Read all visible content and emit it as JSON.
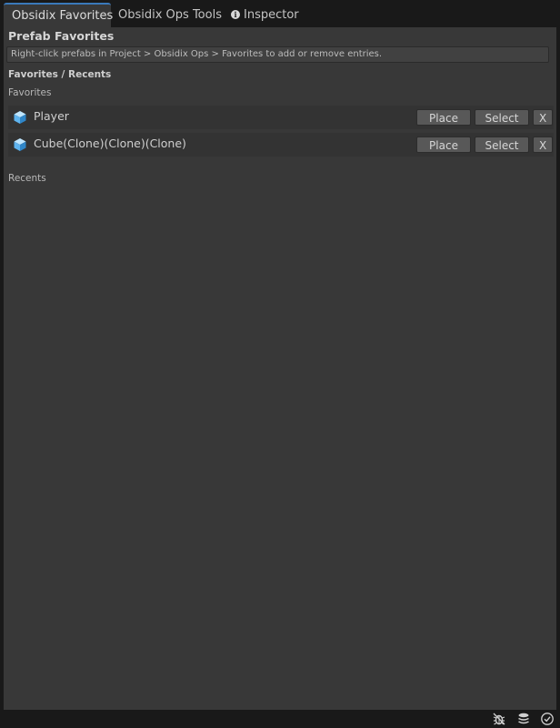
{
  "tabs": {
    "favorites": "Obsidix Favorites",
    "ops_tools": "Obsidix Ops Tools",
    "inspector": "Inspector",
    "inspector_icon": "info-icon"
  },
  "panel": {
    "title": "Prefab Favorites",
    "help_text": "Right-click prefabs in Project > Obsidix Ops > Favorites to add or remove entries.",
    "section_header": "Favorites / Recents",
    "favorites_label": "Favorites",
    "recents_label": "Recents",
    "favorites": [
      {
        "name": "Player",
        "icon": "prefab-cube-icon",
        "place": "Place",
        "select": "Select",
        "remove": "X"
      },
      {
        "name": "Cube(Clone)(Clone)(Clone)",
        "icon": "prefab-cube-icon",
        "place": "Place",
        "select": "Select",
        "remove": "X"
      }
    ],
    "recents": []
  },
  "statusbar": {
    "icons": [
      "debug-bug-icon",
      "layers-icon",
      "check-circle-icon"
    ]
  },
  "colors": {
    "accent": "#3a79bb",
    "panel_bg": "#383838",
    "chrome_bg": "#191919",
    "button_bg": "#585858",
    "prefab_icon": "#5fb4ef"
  }
}
